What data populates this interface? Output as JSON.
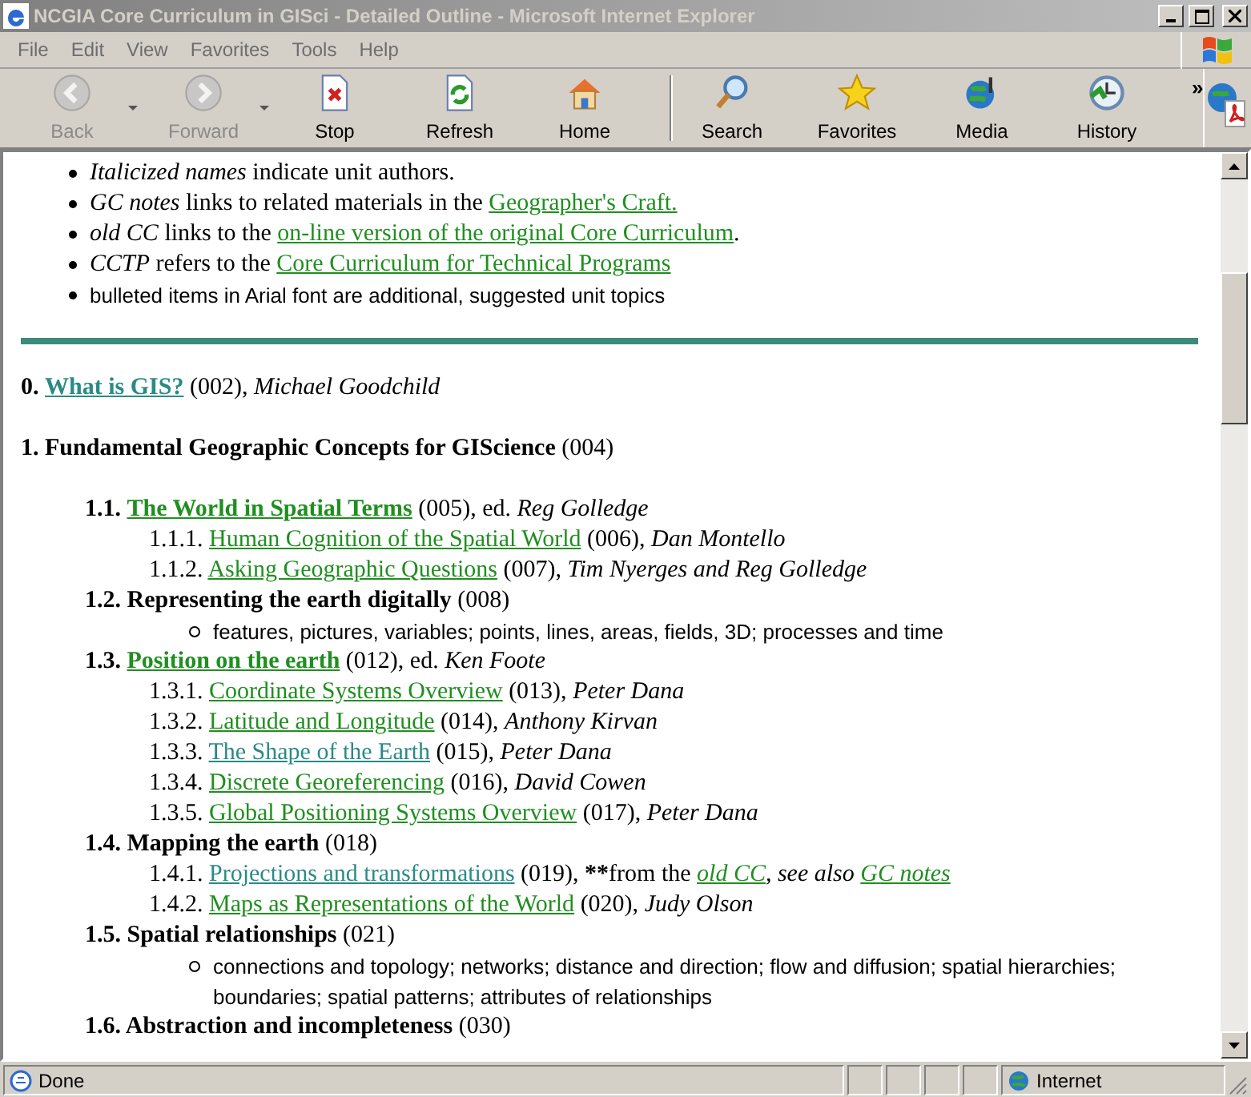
{
  "window": {
    "title": "NCGIA Core Curriculum in GISci - Detailed Outline - Microsoft Internet Explorer"
  },
  "menu": [
    "File",
    "Edit",
    "View",
    "Favorites",
    "Tools",
    "Help"
  ],
  "toolbar": [
    {
      "label": "Back",
      "kind": "back",
      "disabled": true,
      "dropdown": true
    },
    {
      "label": "Forward",
      "kind": "forward",
      "disabled": true,
      "dropdown": true
    },
    {
      "label": "Stop",
      "kind": "stop",
      "disabled": false,
      "dropdown": false
    },
    {
      "label": "Refresh",
      "kind": "refresh",
      "disabled": false,
      "dropdown": false
    },
    {
      "label": "Home",
      "kind": "home",
      "disabled": false,
      "dropdown": false
    },
    {
      "label": "Search",
      "kind": "search",
      "disabled": false,
      "dropdown": false
    },
    {
      "label": "Favorites",
      "kind": "favorites",
      "disabled": false,
      "dropdown": false
    },
    {
      "label": "Media",
      "kind": "media",
      "disabled": false,
      "dropdown": false
    },
    {
      "label": "History",
      "kind": "history",
      "disabled": false,
      "dropdown": false
    }
  ],
  "toolbar_more": "»",
  "legend": [
    {
      "kind": "serif",
      "parts": [
        {
          "kind": "text",
          "text": "*Italicized names* indicate unit authors."
        }
      ]
    },
    {
      "kind": "serif",
      "parts": [
        {
          "kind": "text",
          "text": "*GC notes* links to related materials in the "
        },
        {
          "kind": "link",
          "visited": false,
          "text": "Geographer's Craft."
        }
      ]
    },
    {
      "kind": "serif",
      "parts": [
        {
          "kind": "text",
          "text": "*old CC* links to the "
        },
        {
          "kind": "link",
          "visited": false,
          "text": "on-line version of the original Core Curriculum"
        },
        {
          "kind": "text",
          "text": "."
        }
      ]
    },
    {
      "kind": "serif",
      "parts": [
        {
          "kind": "text",
          "text": "*CCTP* refers to the "
        },
        {
          "kind": "link",
          "visited": false,
          "text": "Core Curriculum for Technical Programs"
        }
      ]
    },
    {
      "kind": "arial",
      "parts": [
        {
          "kind": "text",
          "text": "bulleted items in Arial font are additional, suggested unit topics"
        }
      ]
    }
  ],
  "outline": [
    {
      "kind": "unit",
      "parts": [
        {
          "kind": "text",
          "text": "**0.** "
        },
        {
          "kind": "heading-link",
          "visited": true,
          "text": "What is GIS?"
        },
        {
          "kind": "text",
          "text": " (002), *Michael Goodchild*"
        }
      ]
    },
    {
      "kind": "unit",
      "parts": [
        {
          "kind": "text",
          "text": "**1. Fundamental Geographic Concepts for GIScience** (004)"
        }
      ],
      "children": [
        {
          "kind": "unit",
          "parts": [
            {
              "kind": "text",
              "text": "**1.1.** "
            },
            {
              "kind": "heading-link",
              "visited": false,
              "text": "The World in Spatial Terms"
            },
            {
              "kind": "text",
              "text": " (005), ed. *Reg Golledge*"
            }
          ],
          "children": [
            {
              "kind": "unit",
              "parts": [
                {
                  "kind": "text",
                  "text": "1.1.1. "
                },
                {
                  "kind": "link",
                  "visited": false,
                  "text": "Human Cognition of the Spatial World"
                },
                {
                  "kind": "text",
                  "text": " (006), *Dan Montello*"
                }
              ]
            },
            {
              "kind": "unit",
              "parts": [
                {
                  "kind": "text",
                  "text": "1.1.2. "
                },
                {
                  "kind": "link",
                  "visited": false,
                  "text": "Asking Geographic Questions"
                },
                {
                  "kind": "text",
                  "text": " (007), *Tim Nyerges and Reg Golledge*"
                }
              ]
            }
          ]
        },
        {
          "kind": "unit",
          "parts": [
            {
              "kind": "text",
              "text": "**1.2. Representing the earth digitally** (008)"
            }
          ],
          "children": [
            {
              "kind": "topic",
              "parts": [
                {
                  "kind": "text",
                  "text": "features, pictures, variables; points, lines, areas, fields, 3D; processes and time"
                }
              ]
            }
          ]
        },
        {
          "kind": "unit",
          "parts": [
            {
              "kind": "text",
              "text": "**1.3.** "
            },
            {
              "kind": "heading-link",
              "visited": false,
              "text": "Position on the earth"
            },
            {
              "kind": "text",
              "text": " (012), ed. *Ken Foote*"
            }
          ],
          "children": [
            {
              "kind": "unit",
              "parts": [
                {
                  "kind": "text",
                  "text": "1.3.1. "
                },
                {
                  "kind": "link",
                  "visited": false,
                  "text": "Coordinate Systems Overview"
                },
                {
                  "kind": "text",
                  "text": " (013), *Peter Dana*"
                }
              ]
            },
            {
              "kind": "unit",
              "parts": [
                {
                  "kind": "text",
                  "text": "1.3.2. "
                },
                {
                  "kind": "link",
                  "visited": false,
                  "text": "Latitude and Longitude"
                },
                {
                  "kind": "text",
                  "text": " (014), *Anthony Kirvan*"
                }
              ]
            },
            {
              "kind": "unit",
              "parts": [
                {
                  "kind": "text",
                  "text": "1.3.3. "
                },
                {
                  "kind": "link",
                  "visited": true,
                  "text": "The Shape of the Earth"
                },
                {
                  "kind": "text",
                  "text": " (015), *Peter Dana*"
                }
              ]
            },
            {
              "kind": "unit",
              "parts": [
                {
                  "kind": "text",
                  "text": "1.3.4. "
                },
                {
                  "kind": "link",
                  "visited": false,
                  "text": "Discrete Georeferencing"
                },
                {
                  "kind": "text",
                  "text": " (016), *David Cowen*"
                }
              ]
            },
            {
              "kind": "unit",
              "parts": [
                {
                  "kind": "text",
                  "text": "1.3.5. "
                },
                {
                  "kind": "link",
                  "visited": false,
                  "text": "Global Positioning Systems Overview"
                },
                {
                  "kind": "text",
                  "text": " (017), *Peter Dana*"
                }
              ]
            }
          ]
        },
        {
          "kind": "unit",
          "parts": [
            {
              "kind": "text",
              "text": "**1.4. Mapping the earth** (018)"
            }
          ],
          "children": [
            {
              "kind": "unit",
              "parts": [
                {
                  "kind": "text",
                  "text": "1.4.1. "
                },
                {
                  "kind": "link",
                  "visited": true,
                  "text": "Projections and transformations"
                },
                {
                  "kind": "text",
                  "text": " (019), "
                },
                {
                  "kind": "strong",
                  "text": "**"
                },
                {
                  "kind": "text",
                  "text": "from the "
                },
                {
                  "kind": "italic-link",
                  "visited": false,
                  "text": "old CC"
                },
                {
                  "kind": "text",
                  "text": "*, see also* "
                },
                {
                  "kind": "italic-link",
                  "visited": false,
                  "text": "GC notes"
                }
              ]
            },
            {
              "kind": "unit",
              "parts": [
                {
                  "kind": "text",
                  "text": "1.4.2. "
                },
                {
                  "kind": "link",
                  "visited": false,
                  "text": "Maps as Representations of the World"
                },
                {
                  "kind": "text",
                  "text": " (020), *Judy Olson*"
                }
              ]
            }
          ]
        },
        {
          "kind": "unit",
          "parts": [
            {
              "kind": "text",
              "text": "**1.5. Spatial relationships** (021)"
            }
          ],
          "children": [
            {
              "kind": "topic",
              "parts": [
                {
                  "kind": "text",
                  "text": "connections and topology; networks; distance and direction; flow and diffusion; spatial hierarchies; boundaries; spatial patterns; attributes of relationships"
                }
              ]
            }
          ]
        },
        {
          "kind": "unit",
          "parts": [
            {
              "kind": "text",
              "text": "**1.6. Abstraction and incompleteness** (030)"
            }
          ]
        }
      ]
    }
  ],
  "status_bar": {
    "text": "Done",
    "zone": "Internet"
  }
}
